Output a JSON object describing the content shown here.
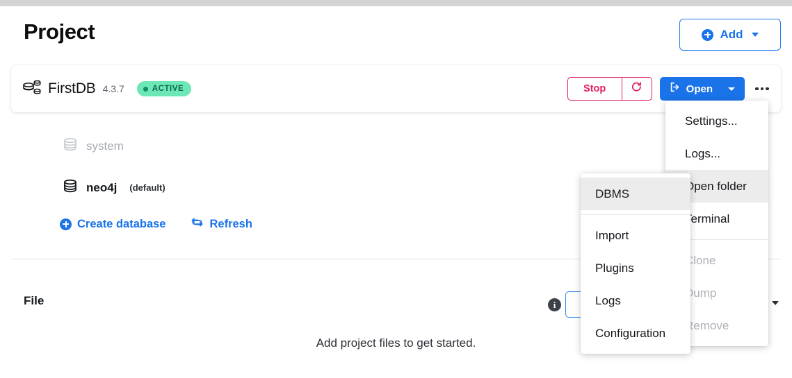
{
  "page": {
    "title": "Project",
    "empty_message": "Add project files to get started."
  },
  "header": {
    "add_button": "Add",
    "add_icon": "plus-circle-icon",
    "add_caret_icon": "chevron-down-icon"
  },
  "dbms": {
    "icon": "database-cluster-icon",
    "name": "FirstDB",
    "version": "4.3.7",
    "status_badge": "ACTIVE",
    "status_dot_color": "#0f8f63",
    "badge_bg": "#6ee7b7",
    "stop_button": "Stop",
    "restart_icon": "restart-icon",
    "open_button": "Open",
    "open_icon": "external-link-icon",
    "open_caret_icon": "chevron-down-icon",
    "more_button_icon": "ellipsis-icon",
    "accent_blue": "#1a73e8",
    "danger_red": "#e01e5a"
  },
  "databases": [
    {
      "name": "system",
      "icon": "database-icon",
      "muted": true,
      "suffix": ""
    },
    {
      "name": "neo4j",
      "icon": "database-icon",
      "muted": false,
      "suffix": "(default)"
    }
  ],
  "db_actions": {
    "create": "Create database",
    "create_icon": "plus-circle-icon",
    "refresh": "Refresh",
    "refresh_icon": "refresh-icon"
  },
  "file_section": {
    "label": "File",
    "info_icon": "info-icon",
    "info_glyph": "i",
    "input_value": "",
    "input_placeholder": "",
    "caret_icon": "chevron-down-icon"
  },
  "context_menu": {
    "items": [
      {
        "label": "Settings...",
        "state": "normal"
      },
      {
        "label": "Logs...",
        "state": "normal"
      },
      {
        "label": "Open folder",
        "state": "highlighted"
      },
      {
        "label": "Terminal",
        "state": "normal"
      },
      {
        "label": "__sep__",
        "state": "separator"
      },
      {
        "label": "Clone",
        "state": "disabled"
      },
      {
        "label": "Dump",
        "state": "disabled"
      },
      {
        "label": "Remove",
        "state": "disabled"
      }
    ]
  },
  "submenu": {
    "items": [
      {
        "label": "DBMS",
        "state": "highlighted"
      },
      {
        "label": "__sep__",
        "state": "separator"
      },
      {
        "label": "Import",
        "state": "normal"
      },
      {
        "label": "Plugins",
        "state": "normal"
      },
      {
        "label": "Logs",
        "state": "normal"
      },
      {
        "label": "Configuration",
        "state": "normal"
      }
    ]
  }
}
